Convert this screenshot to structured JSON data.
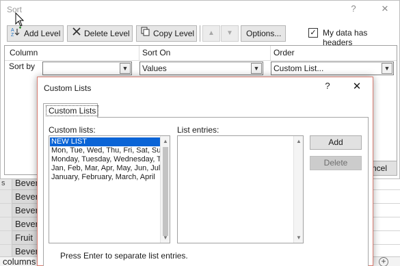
{
  "sort_dialog": {
    "title": "Sort",
    "help_glyph": "?",
    "close_glyph": "✕",
    "toolbar": {
      "add_level": "Add Level",
      "delete_level": "Delete Level",
      "copy_level": "Copy Level",
      "move_up_glyph": "▲",
      "move_down_glyph": "▼",
      "options": "Options...",
      "my_data_has_headers": "My data has headers",
      "headers_checked_glyph": "✓"
    },
    "columns": {
      "column": "Column",
      "sort_on": "Sort On",
      "order": "Order"
    },
    "row": {
      "sort_by_label": "Sort by",
      "column_value": "",
      "sort_on_value": "Values",
      "order_value": "Custom List..."
    },
    "cancel_partial": "ncel"
  },
  "custom_lists_dialog": {
    "title": "Custom Lists",
    "help_glyph": "?",
    "close_glyph": "✕",
    "tab_label": "Custom Lists",
    "custom_lists_label": "Custom lists:",
    "list_entries_label": "List entries:",
    "custom_lists": [
      "NEW LIST",
      "Mon, Tue, Wed, Thu, Fri, Sat, Sun",
      "Monday, Tuesday, Wednesday, Thursday",
      "Jan, Feb, Mar, Apr, May, Jun, Jul",
      "January, February, March, April"
    ],
    "selected_index": 0,
    "add_button": "Add",
    "delete_button": "Delete",
    "hint": "Press Enter to separate list entries."
  },
  "worksheet": {
    "rows": [
      {
        "row_header": "s",
        "cell": "Bever"
      },
      {
        "row_header": "",
        "cell": "Bever"
      },
      {
        "row_header": "",
        "cell": "Bever"
      },
      {
        "row_header": "",
        "cell": "Bever"
      },
      {
        "row_header": "",
        "cell": "Fruit"
      },
      {
        "row_header": "",
        "cell": "Bever"
      }
    ],
    "sheet_tab_label": "columns",
    "new_sheet_glyph": "+"
  },
  "colors": {
    "selection": "#0a64d6",
    "dialog_border_accent": "#d77a6e",
    "cell_fill": "#d9d9d9"
  },
  "icons": [
    "add-level-icon",
    "delete-level-icon",
    "copy-level-icon",
    "mouse-pointer-icon"
  ]
}
